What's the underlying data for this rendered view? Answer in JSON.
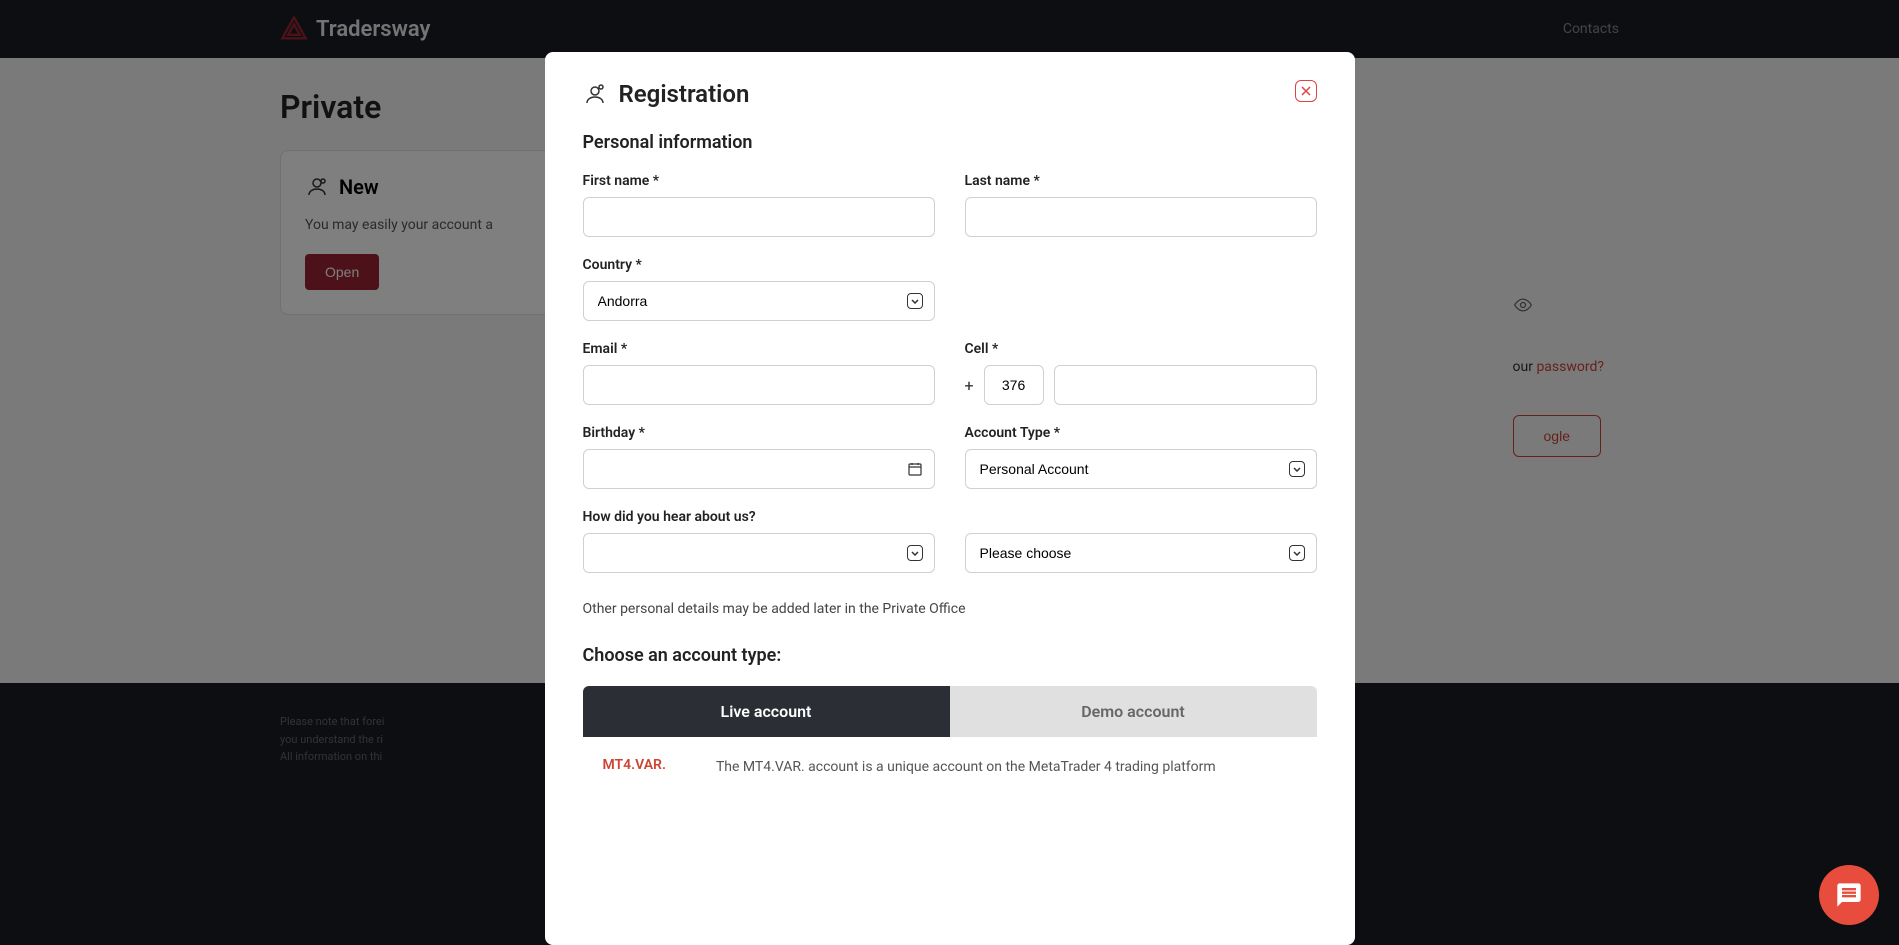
{
  "header": {
    "brand": "Tradersway",
    "contacts": "Contacts"
  },
  "page": {
    "title": "Private"
  },
  "card": {
    "title": "New",
    "text": "You may easily your account a",
    "button": "Open"
  },
  "sidepanel": {
    "forgot_prefix": "our ",
    "forgot_link": "password?",
    "google_btn": "ogle"
  },
  "footer": {
    "line1": "Please note that forei",
    "line2": "you understand the ri",
    "line3": "All information on thi"
  },
  "modal": {
    "title": "Registration",
    "section1": "Personal information",
    "labels": {
      "first_name": "First name *",
      "last_name": "Last name *",
      "country": "Country *",
      "email": "Email *",
      "cell": "Cell *",
      "birthday": "Birthday *",
      "account_type": "Account Type *",
      "hear": "How did you hear about us?"
    },
    "values": {
      "country": "Andorra",
      "cell_code": "376",
      "cell_plus": "+",
      "account_type": "Personal Account",
      "please_choose": "Please choose"
    },
    "note": "Other personal details may be added later in the Private Office",
    "section2": "Choose an account type:",
    "tabs": {
      "live": "Live account",
      "demo": "Demo account"
    },
    "account_preview": {
      "name": "MT4.VAR.",
      "desc": "The MT4.VAR. account is a unique account on the MetaTrader 4 trading platform"
    }
  }
}
